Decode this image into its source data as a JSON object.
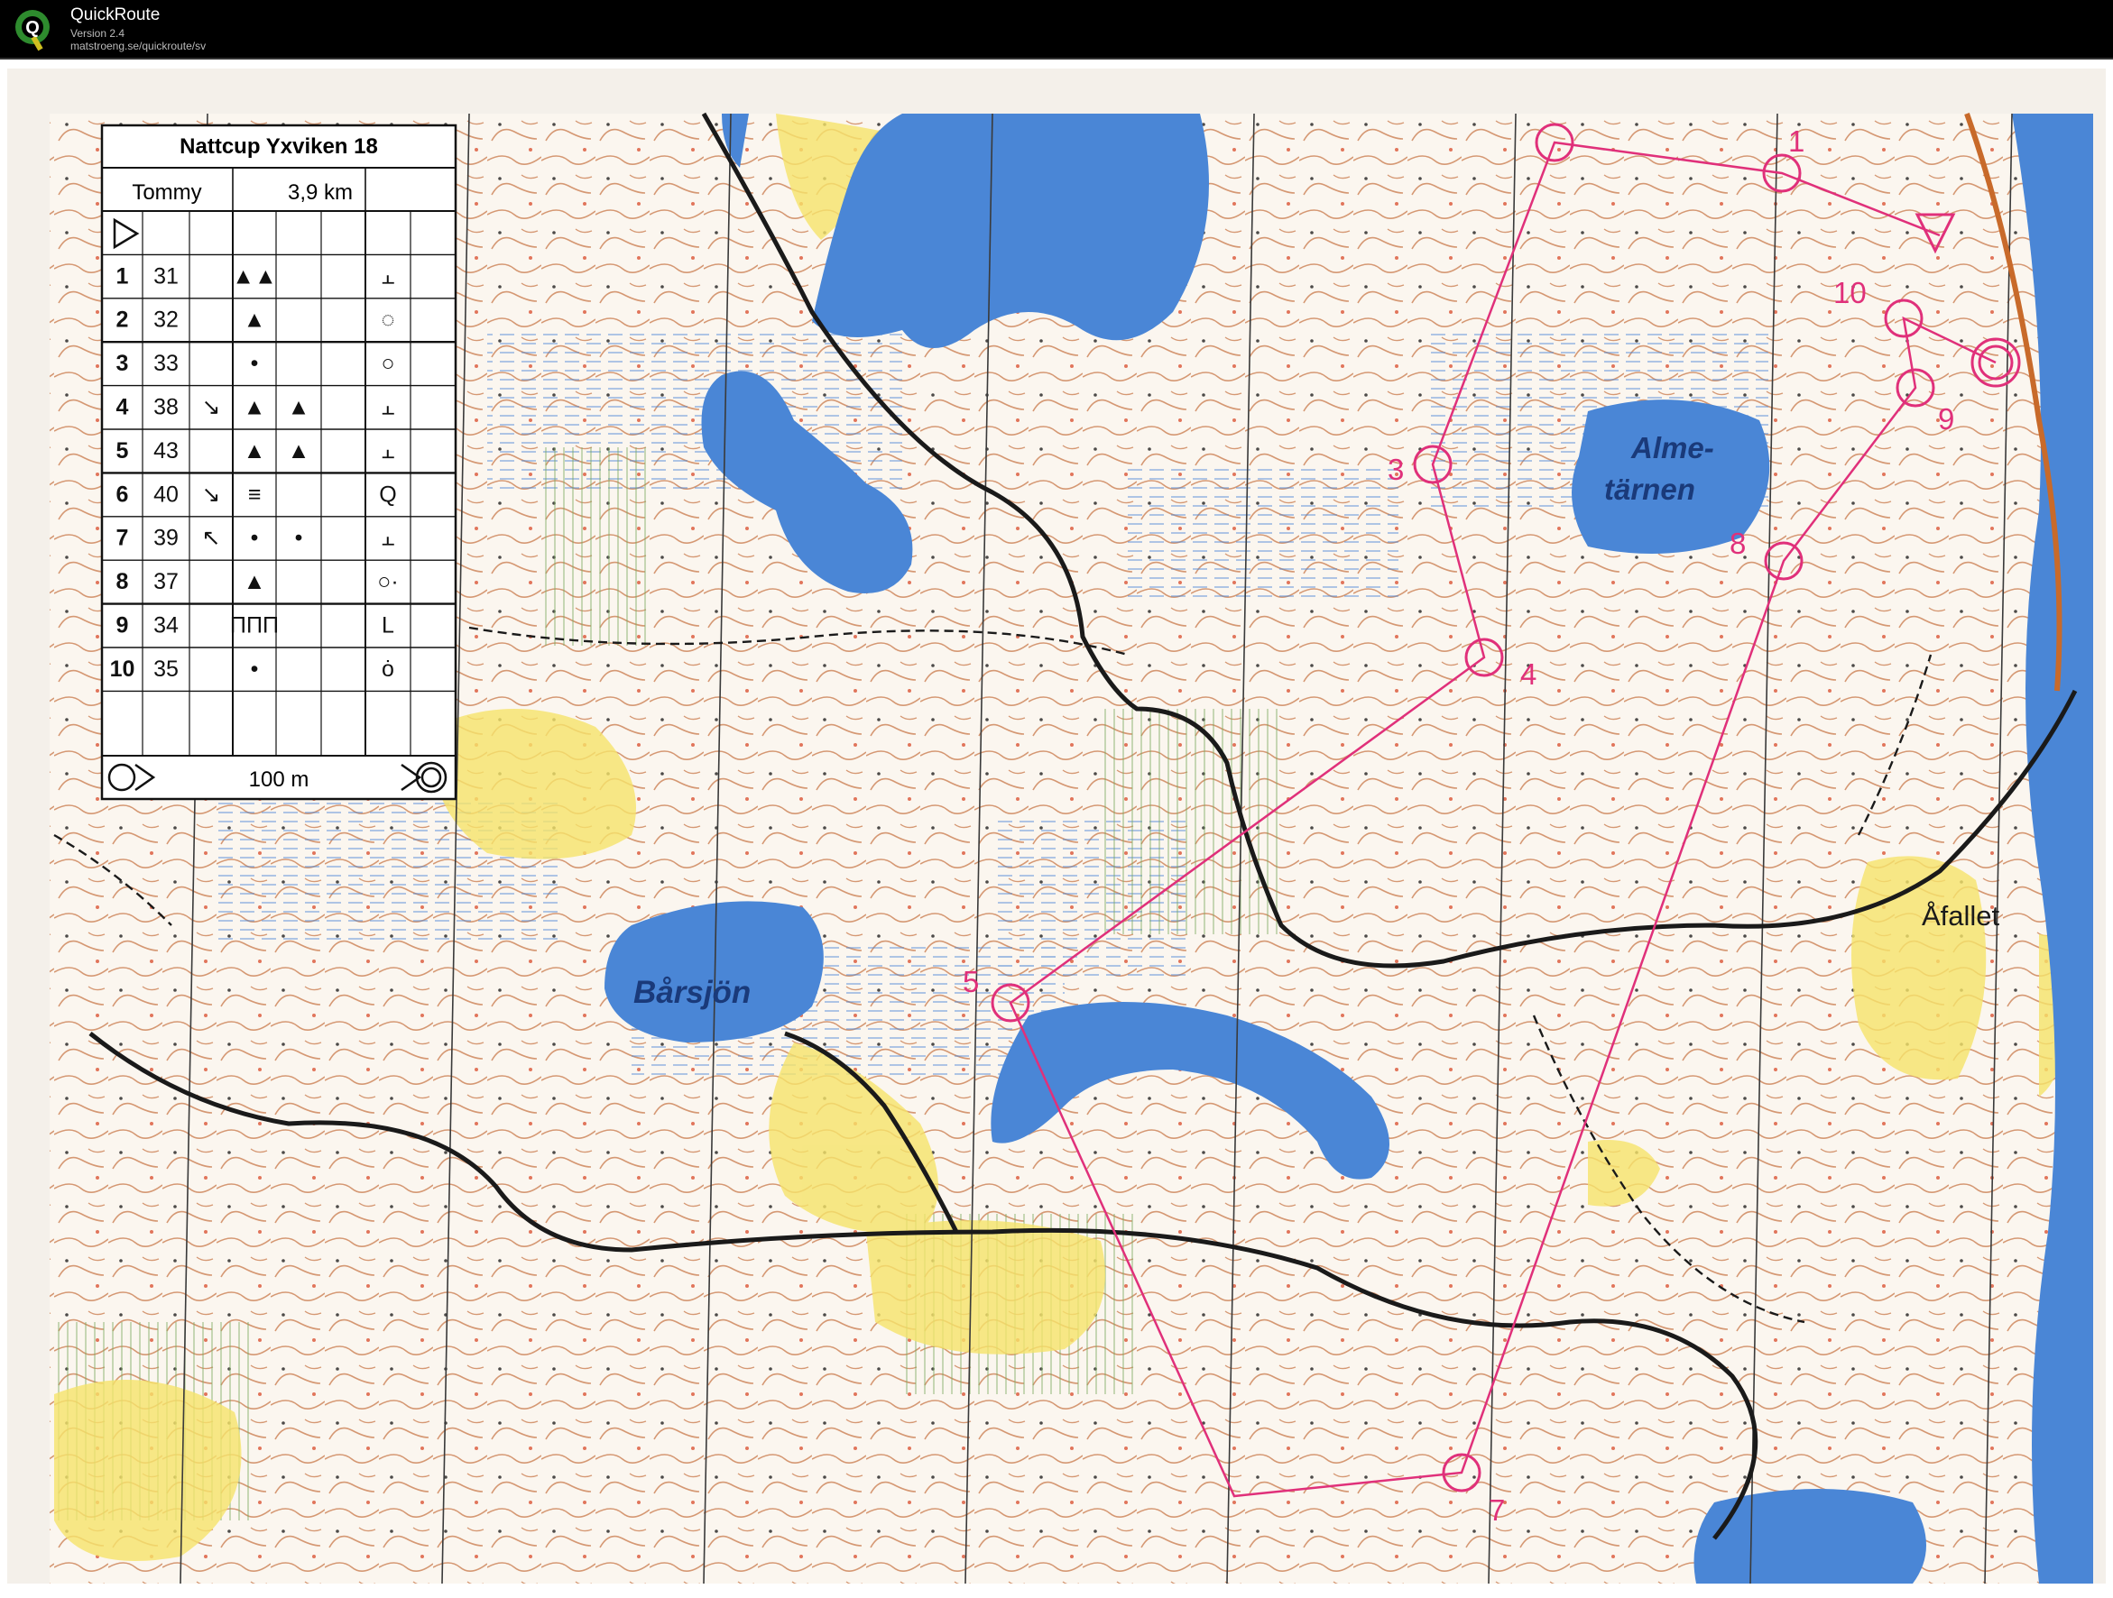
{
  "app": {
    "name": "QuickRoute",
    "version": "Version 2.4",
    "url": "matstroeng.se/quickroute/sv",
    "logo_letter": "Q"
  },
  "colors": {
    "titlebar": "#000000",
    "map_paper": "#fbf6ef",
    "water": "#4a86d6",
    "open_land": "#f6e46a",
    "contour": "#c8784a",
    "course": "#e0307a",
    "road": "#1a1a1a",
    "magnetic_north": "#3a3a3a"
  },
  "control_description": {
    "title": "Nattcup Yxviken 18",
    "course_name": "Tommy",
    "length": "3,9 km",
    "start_symbol": "start-triangle",
    "rows": [
      {
        "no": "1",
        "code": "31",
        "dir": "",
        "feature": "▲▲",
        "detail": "",
        "loc": "⫠"
      },
      {
        "no": "2",
        "code": "32",
        "dir": "",
        "feature": "▲",
        "detail": "",
        "loc": "◌"
      },
      {
        "no": "3",
        "code": "33",
        "dir": "",
        "feature": "•",
        "detail": "",
        "loc": "○"
      },
      {
        "no": "4",
        "code": "38",
        "dir": "↘",
        "feature": "▲",
        "detail": "▲",
        "loc": "⫠"
      },
      {
        "no": "5",
        "code": "43",
        "dir": "",
        "feature": "▲",
        "detail": "▲",
        "loc": "⫠"
      },
      {
        "no": "6",
        "code": "40",
        "dir": "↘",
        "feature": "≡",
        "detail": "",
        "loc": "Q"
      },
      {
        "no": "7",
        "code": "39",
        "dir": "↖",
        "feature": "•",
        "detail": "•",
        "loc": "⫠"
      },
      {
        "no": "8",
        "code": "37",
        "dir": "",
        "feature": "▲",
        "detail": "",
        "loc": "○·"
      },
      {
        "no": "9",
        "code": "34",
        "dir": "",
        "feature": "ΠΠΠ",
        "detail": "",
        "loc": "L"
      },
      {
        "no": "10",
        "code": "35",
        "dir": "",
        "feature": "•",
        "detail": "",
        "loc": "ȯ"
      }
    ],
    "finish_distance": "100 m"
  },
  "map_labels": {
    "lake_1": "Alme-",
    "lake_1b": "tärnen",
    "lake_2": "Bårsjön",
    "place_1": "Åfallet"
  },
  "course": {
    "controls": [
      {
        "label": "1"
      },
      {
        "label": "3"
      },
      {
        "label": "4"
      },
      {
        "label": "5"
      },
      {
        "label": "7"
      },
      {
        "label": "8"
      },
      {
        "label": "9"
      },
      {
        "label": "10"
      }
    ]
  }
}
